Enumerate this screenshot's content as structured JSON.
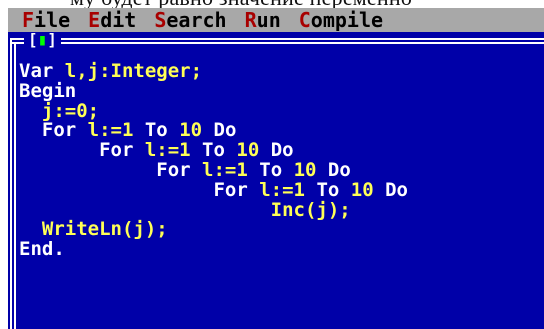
{
  "page": {
    "top_fragment_text": "му будет равно значение переменно"
  },
  "menubar": {
    "items": [
      {
        "hot": "F",
        "rest": "ile"
      },
      {
        "hot": "E",
        "rest": "dit"
      },
      {
        "hot": "S",
        "rest": "earch"
      },
      {
        "hot": "R",
        "rest": "un"
      },
      {
        "hot": "C",
        "rest": "ompile"
      }
    ]
  },
  "window": {
    "close_box_left": "[",
    "close_box_mark": "▮",
    "close_box_right": "]"
  },
  "editor": {
    "lines": [
      {
        "indent": "",
        "parts": [
          {
            "t": "Var",
            "c": "kw"
          },
          {
            "t": " l,j:Integer;",
            "c": "hl"
          }
        ]
      },
      {
        "indent": "",
        "parts": [
          {
            "t": "Begin",
            "c": "kw"
          }
        ]
      },
      {
        "indent": "  ",
        "parts": [
          {
            "t": "j:=0;",
            "c": "hl"
          }
        ]
      },
      {
        "indent": "  ",
        "parts": [
          {
            "t": "For ",
            "c": "kw"
          },
          {
            "t": "l:=1",
            "c": "hl"
          },
          {
            "t": " To ",
            "c": "kw"
          },
          {
            "t": "10",
            "c": "hl"
          },
          {
            "t": " Do",
            "c": "kw"
          }
        ]
      },
      {
        "indent": "       ",
        "parts": [
          {
            "t": "For ",
            "c": "kw"
          },
          {
            "t": "l:=1",
            "c": "hl"
          },
          {
            "t": " To ",
            "c": "kw"
          },
          {
            "t": "10",
            "c": "hl"
          },
          {
            "t": " Do",
            "c": "kw"
          }
        ]
      },
      {
        "indent": "            ",
        "parts": [
          {
            "t": "For ",
            "c": "kw"
          },
          {
            "t": "l:=1",
            "c": "hl"
          },
          {
            "t": " To ",
            "c": "kw"
          },
          {
            "t": "10",
            "c": "hl"
          },
          {
            "t": " Do",
            "c": "kw"
          }
        ]
      },
      {
        "indent": "                 ",
        "parts": [
          {
            "t": "For ",
            "c": "kw"
          },
          {
            "t": "l:=1",
            "c": "hl"
          },
          {
            "t": " To ",
            "c": "kw"
          },
          {
            "t": "10",
            "c": "hl"
          },
          {
            "t": " Do",
            "c": "kw"
          }
        ]
      },
      {
        "indent": "                      ",
        "parts": [
          {
            "t": "Inc(j);",
            "c": "hl"
          }
        ]
      },
      {
        "indent": "  ",
        "parts": [
          {
            "t": "WriteLn(j);",
            "c": "hl"
          }
        ]
      },
      {
        "indent": "",
        "parts": [
          {
            "t": "End.",
            "c": "kw"
          }
        ]
      }
    ]
  },
  "colors": {
    "editor_background": "#0000a8",
    "menubar_background": "#a8a8a8",
    "hotkey": "#a80000",
    "keyword": "#ffffff",
    "highlight": "#ffff55",
    "close_box_mark": "#00ff00"
  }
}
